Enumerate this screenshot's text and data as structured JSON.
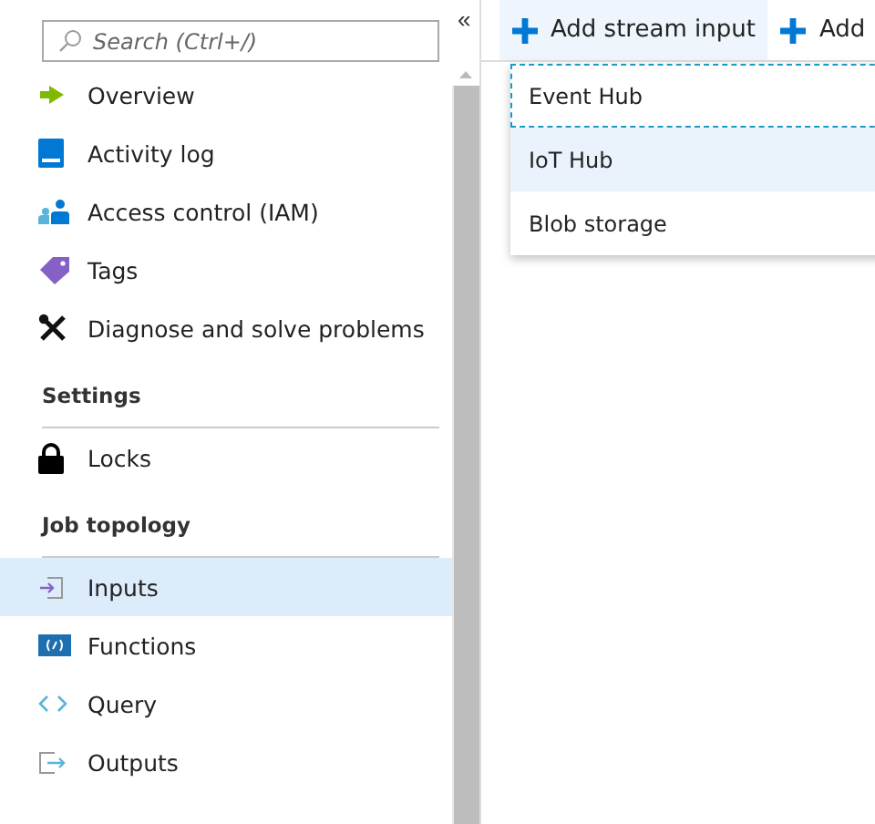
{
  "sidebar": {
    "search": {
      "placeholder": "Search (Ctrl+/)"
    },
    "collapse": "«",
    "groups": [
      {
        "items": [
          {
            "label": "Overview",
            "kind": "overview",
            "selected": false
          },
          {
            "label": "Activity log",
            "kind": "log",
            "selected": false
          },
          {
            "label": "Access control (IAM)",
            "kind": "iam",
            "selected": false
          },
          {
            "label": "Tags",
            "kind": "tag",
            "selected": false
          },
          {
            "label": "Diagnose and solve problems",
            "kind": "tools",
            "selected": false
          }
        ]
      },
      {
        "title": "Settings",
        "items": [
          {
            "label": "Locks",
            "kind": "lock",
            "selected": false
          }
        ]
      },
      {
        "title": "Job topology",
        "items": [
          {
            "label": "Inputs",
            "kind": "input",
            "selected": true
          },
          {
            "label": "Functions",
            "kind": "function",
            "selected": false
          },
          {
            "label": "Query",
            "kind": "query",
            "selected": false
          },
          {
            "label": "Outputs",
            "kind": "output",
            "selected": false
          }
        ]
      }
    ]
  },
  "toolbar": [
    {
      "label": "Add stream input",
      "open": true
    },
    {
      "label": "Add",
      "open": false
    }
  ],
  "menu": [
    {
      "label": "Event Hub",
      "focused": true,
      "hovered": false
    },
    {
      "label": "IoT Hub",
      "focused": false,
      "hovered": true
    },
    {
      "label": "Blob storage",
      "focused": false,
      "hovered": false
    }
  ]
}
